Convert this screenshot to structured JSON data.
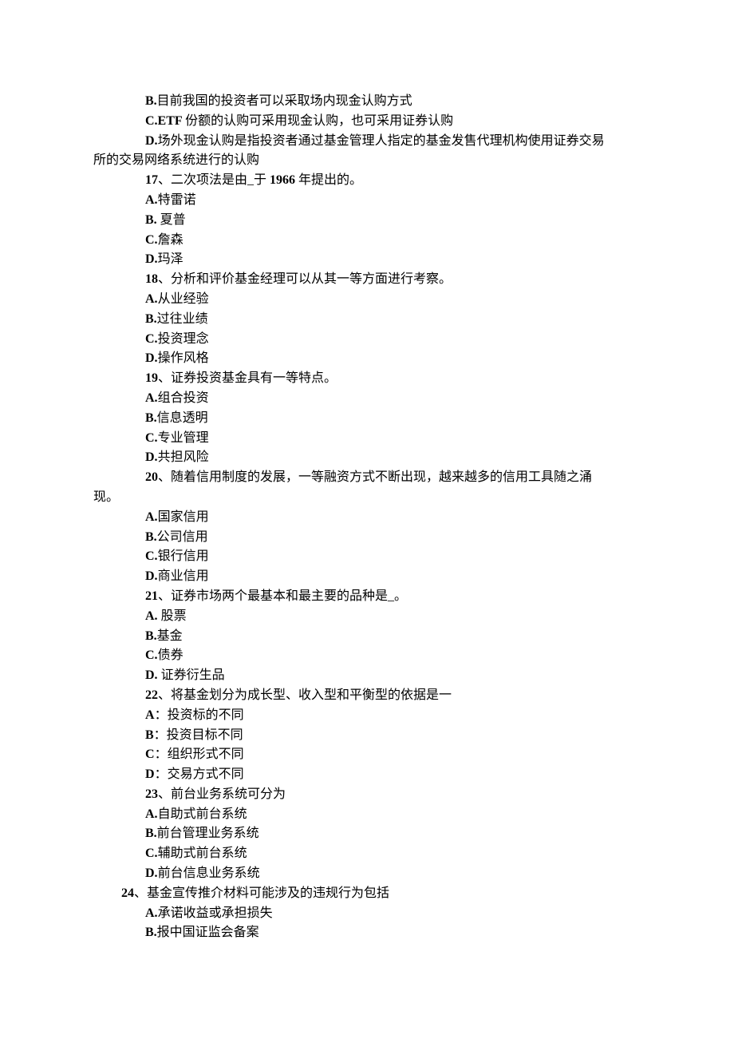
{
  "lines": [
    {
      "indent": "ind1",
      "bold_prefix": "B.",
      "text": "目前我国的投资者可以采取场内现金认购方式"
    },
    {
      "indent": "ind1",
      "bold_prefix": "C.ETF ",
      "text": "份额的认购可采用现金认购，也可采用证券认购"
    },
    {
      "indent": "ind1",
      "bold_prefix": "D.",
      "text": "场外现金认购是指投资者通过基金管理人指定的基金发售代理机构使用证券交易"
    },
    {
      "indent": "ind0",
      "bold_prefix": "",
      "text": "所的交易网络系统进行的认购"
    },
    {
      "indent": "ind1",
      "bold_prefix": "17",
      "text": "、二次项法是由_于 ",
      "bold_suffix": "1966 ",
      "tail": "年提出的。"
    },
    {
      "indent": "ind1",
      "bold_prefix": "A.",
      "text": "特雷诺"
    },
    {
      "indent": "ind1",
      "bold_prefix": "B. ",
      "text": "夏普"
    },
    {
      "indent": "ind1",
      "bold_prefix": "C.",
      "text": "詹森"
    },
    {
      "indent": "ind1",
      "bold_prefix": "D.",
      "text": "玛泽"
    },
    {
      "indent": "ind1",
      "bold_prefix": "18",
      "text": "、分析和评价基金经理可以从其一等方面进行考察。"
    },
    {
      "indent": "ind1",
      "bold_prefix": "A.",
      "text": "从业经验"
    },
    {
      "indent": "ind1",
      "bold_prefix": "B.",
      "text": "过往业绩"
    },
    {
      "indent": "ind1",
      "bold_prefix": "C.",
      "text": "投资理念"
    },
    {
      "indent": "ind1",
      "bold_prefix": "D.",
      "text": "操作风格"
    },
    {
      "indent": "ind1",
      "bold_prefix": "19",
      "text": "、证券投资基金具有一等特点。"
    },
    {
      "indent": "ind1",
      "bold_prefix": "A.",
      "text": "组合投资"
    },
    {
      "indent": "ind1",
      "bold_prefix": "B.",
      "text": "信息透明"
    },
    {
      "indent": "ind1",
      "bold_prefix": "C.",
      "text": "专业管理"
    },
    {
      "indent": "ind1",
      "bold_prefix": "D.",
      "text": "共担风险"
    },
    {
      "indent": "ind1",
      "bold_prefix": "20",
      "text": "、随着信用制度的发展，一等融资方式不断出现，越来越多的信用工具随之涌"
    },
    {
      "indent": "ind0",
      "bold_prefix": "",
      "text": "现。"
    },
    {
      "indent": "ind1",
      "bold_prefix": "A.",
      "text": "国家信用"
    },
    {
      "indent": "ind1",
      "bold_prefix": "B.",
      "text": "公司信用"
    },
    {
      "indent": "ind1",
      "bold_prefix": "C.",
      "text": "银行信用"
    },
    {
      "indent": "ind1",
      "bold_prefix": "D.",
      "text": "商业信用"
    },
    {
      "indent": "ind1",
      "bold_prefix": "21",
      "text": "、证券市场两个最基本和最主要的品种是_。"
    },
    {
      "indent": "ind1",
      "bold_prefix": "A. ",
      "text": "股票"
    },
    {
      "indent": "ind1",
      "bold_prefix": "B.",
      "text": "基金"
    },
    {
      "indent": "ind1",
      "bold_prefix": "C.",
      "text": "债券"
    },
    {
      "indent": "ind1",
      "bold_prefix": "D. ",
      "text": "证券衍生品"
    },
    {
      "indent": "ind1",
      "bold_prefix": "22",
      "text": "、将基金划分为成长型、收入型和平衡型的依据是一"
    },
    {
      "indent": "ind1",
      "bold_prefix": "A",
      "text": "：投资标的不同"
    },
    {
      "indent": "ind1",
      "bold_prefix": "B",
      "text": "：投资目标不同"
    },
    {
      "indent": "ind1",
      "bold_prefix": "C",
      "text": "：组织形式不同"
    },
    {
      "indent": "ind1",
      "bold_prefix": "D",
      "text": "：交易方式不同"
    },
    {
      "indent": "ind1",
      "bold_prefix": "23",
      "text": "、前台业务系统可分为"
    },
    {
      "indent": "ind1",
      "bold_prefix": "A.",
      "text": "自助式前台系统"
    },
    {
      "indent": "ind1",
      "bold_prefix": "B.",
      "text": "前台管理业务系统"
    },
    {
      "indent": "ind1",
      "bold_prefix": "C.",
      "text": "辅助式前台系统"
    },
    {
      "indent": "ind1",
      "bold_prefix": "D.",
      "text": "前台信息业务系统"
    },
    {
      "indent": "ind2",
      "bold_prefix": "24",
      "text": "、基金宣传推介材料可能涉及的违规行为包括"
    },
    {
      "indent": "ind1",
      "bold_prefix": "A.",
      "text": "承诺收益或承担损失"
    },
    {
      "indent": "ind1",
      "bold_prefix": "B.",
      "text": "报中国证监会备案"
    }
  ]
}
